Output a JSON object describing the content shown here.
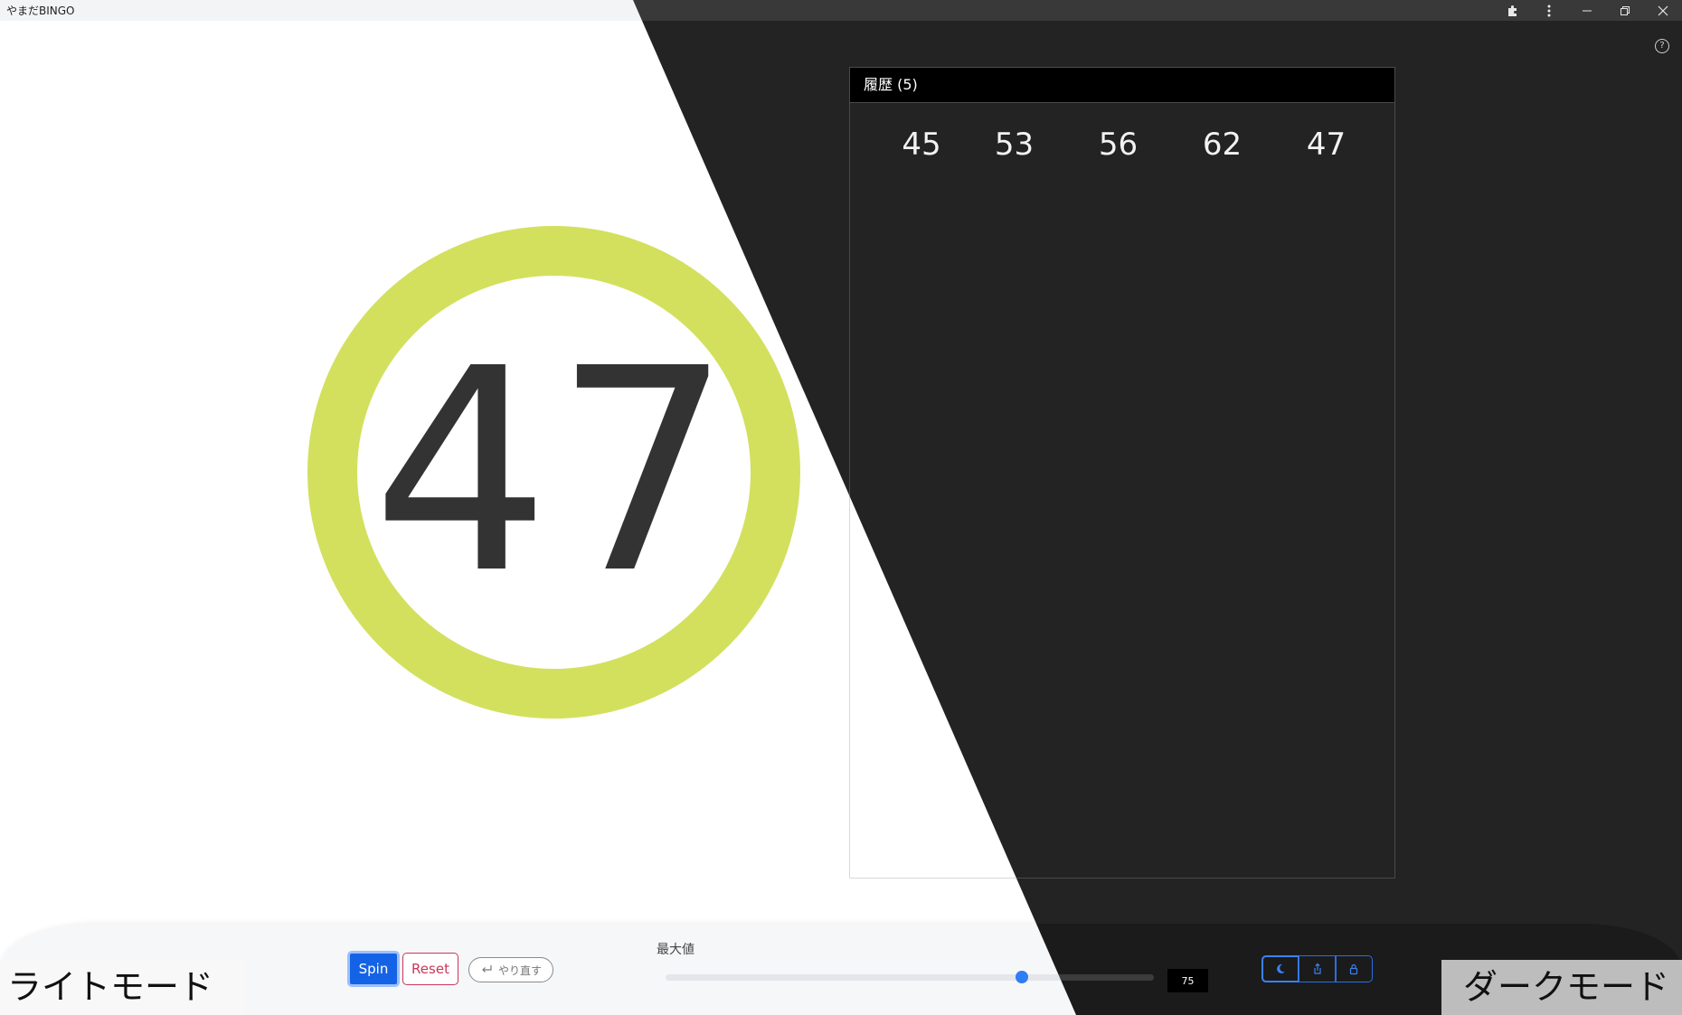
{
  "window": {
    "title": "やまだBINGO",
    "controls": [
      "extensions-icon",
      "more-vert-icon",
      "minimize-icon",
      "restore-icon",
      "close-icon"
    ]
  },
  "help": {
    "label": "?"
  },
  "current_number": "47",
  "history": {
    "header": "履歴 (5)",
    "numbers": [
      "45",
      "53",
      "56",
      "62",
      "47"
    ]
  },
  "controls": {
    "spin_label": "Spin",
    "reset_label": "Reset",
    "redo_label": "やり直す",
    "max_label": "最大値",
    "max_value": "75",
    "slider_fraction": 0.73,
    "mode_buttons": [
      "moon-icon",
      "share-icon",
      "lock-icon"
    ]
  },
  "captions": {
    "light": "ライトモード",
    "dark": "ダークモード"
  },
  "colors": {
    "ball_ring": "#d3e05e",
    "spin_bg": "#1463e6",
    "reset": "#c9365b",
    "dark_bg": "#232323"
  }
}
